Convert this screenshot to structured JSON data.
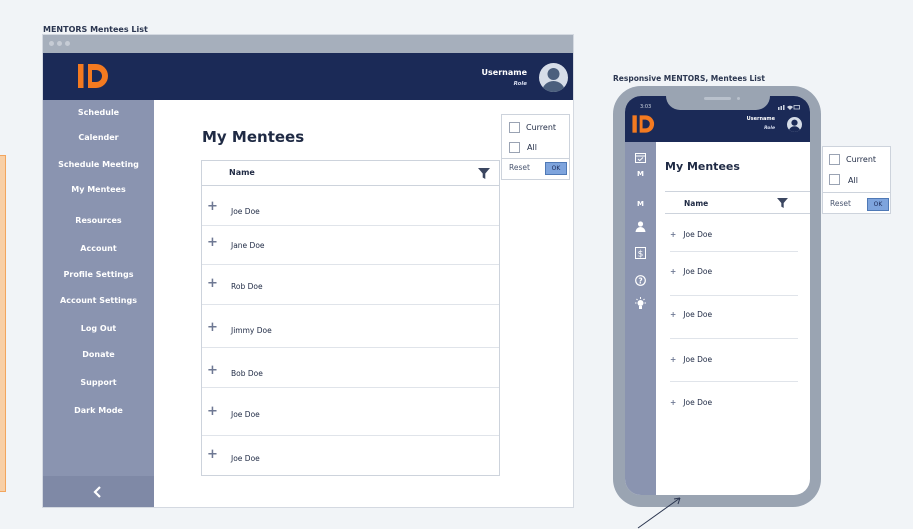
{
  "captions": {
    "desktop": "MENTORS Mentees List",
    "mobile": "Responsive MENTORS,  Mentees List"
  },
  "header": {
    "username": "Username",
    "role": "Role"
  },
  "sidebar": {
    "items": [
      {
        "label": "Schedule"
      },
      {
        "label": "Calender"
      },
      {
        "label": "Schedule Meeting"
      },
      {
        "label": "My Mentees"
      },
      {
        "label": "Resources"
      },
      {
        "label": "Account"
      },
      {
        "label": "Profile Settings"
      },
      {
        "label": "Account Settings"
      },
      {
        "label": "Log Out"
      },
      {
        "label": "Donate"
      },
      {
        "label": "Support"
      },
      {
        "label": "Dark Mode"
      }
    ],
    "collapse_icon": "chevron-left-icon"
  },
  "main": {
    "title": "My Mentees",
    "column_header": "Name",
    "rows": [
      "Joe Doe",
      "Jane Doe",
      "Rob Doe",
      "Jimmy Doe",
      "Bob Doe",
      "Joe Doe",
      "Joe Doe"
    ]
  },
  "filter": {
    "options": [
      "Current",
      "All"
    ],
    "reset_label": "Reset",
    "ok_label": "OK"
  },
  "mobile": {
    "title": "My Mentees",
    "column_header": "Name",
    "rows": [
      "Joe Doe",
      "Joe Doe",
      "Joe Doe",
      "Joe Doe",
      "Joe Doe"
    ],
    "username": "Username",
    "role": "Role",
    "nav": [
      "M",
      "M"
    ],
    "status_time": "3:03",
    "filter": {
      "options": [
        "Current",
        "All"
      ],
      "reset_label": "Reset",
      "ok_label": "OK"
    }
  },
  "colors": {
    "header_navy": "#1b2a57",
    "sidebar": "#8a94b0",
    "logo_orange": "#f47a20",
    "ok_blue": "#7ea4dd"
  }
}
